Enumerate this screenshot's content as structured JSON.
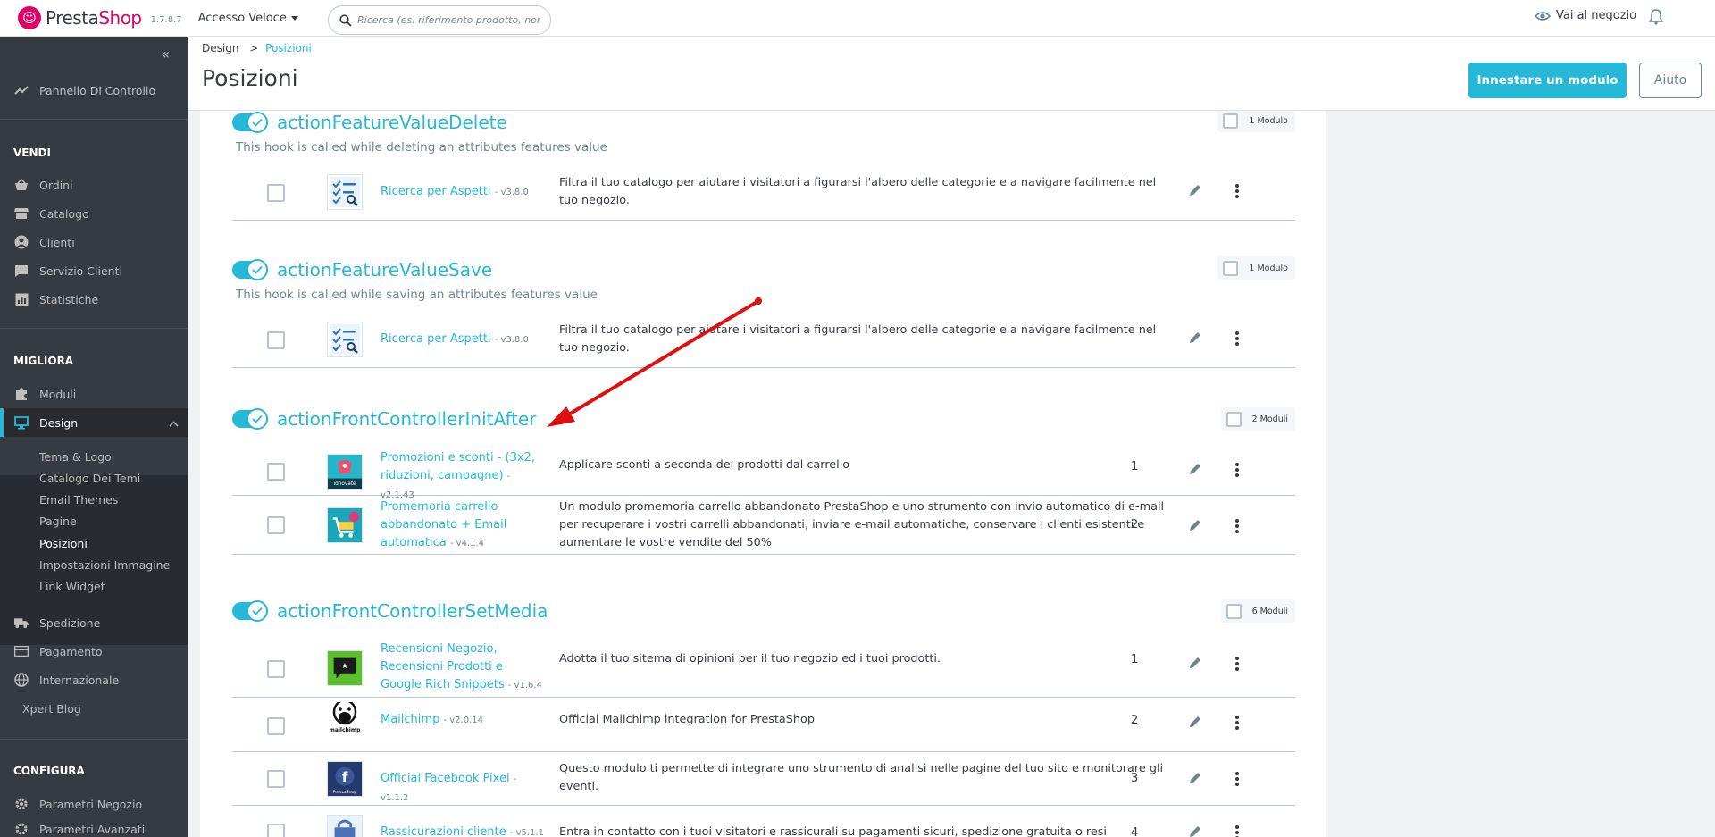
{
  "header": {
    "logo_prefix": "Presta",
    "logo_suffix": "Shop",
    "version": "1.7.8.7",
    "quick_access": "Accesso Veloce",
    "search_placeholder": "Ricerca (es. riferimento prodotto, nom",
    "shop_link": "Vai al negozio"
  },
  "sidebar": {
    "dashboard": "Pannello Di Controllo",
    "sections": {
      "sell": "VENDI",
      "improve": "MIGLIORA",
      "configure": "CONFIGURA"
    },
    "sell_items": [
      "Ordini",
      "Catalogo",
      "Clienti",
      "Servizio Clienti",
      "Statistiche"
    ],
    "improve_items": [
      "Moduli",
      "Design"
    ],
    "design_sub": [
      "Tema & Logo",
      "Catalogo Dei Temi",
      "Email Themes",
      "Pagine",
      "Posizioni",
      "Impostazioni Immagine",
      "Link Widget"
    ],
    "other_items": [
      "Spedizione",
      "Pagamento",
      "Internazionale",
      "Xpert Blog"
    ],
    "configure_items": [
      "Parametri Negozio",
      "Parametri Avanzati"
    ]
  },
  "page": {
    "breadcrumb_parent": "Design",
    "breadcrumb_sep": ">",
    "breadcrumb_current": "Posizioni",
    "title": "Posizioni",
    "primary_button": "Innestare un modulo",
    "help_button": "Aiuto"
  },
  "hooks": [
    {
      "name": "actionFeatureValueDelete",
      "description": "This hook is called while deleting an attributes features value",
      "count": "1 Modulo",
      "modules": [
        {
          "name": "Ricerca per Aspetti",
          "version": "- v3.8.0",
          "description": "Filtra il tuo catalogo per aiutare i visitatori a figurarsi l'albero delle categorie e a navigare facilmente nel tuo negozio.",
          "position": ""
        }
      ]
    },
    {
      "name": "actionFeatureValueSave",
      "description": "This hook is called while saving an attributes features value",
      "count": "1 Modulo",
      "modules": [
        {
          "name": "Ricerca per Aspetti",
          "version": "- v3.8.0",
          "description": "Filtra il tuo catalogo per aiutare i visitatori a figurarsi l'albero delle categorie e a navigare facilmente nel tuo negozio.",
          "position": ""
        }
      ]
    },
    {
      "name": "actionFrontControllerInitAfter",
      "description": "",
      "count": "2 Moduli",
      "modules": [
        {
          "name": "Promozioni e sconti - (3x2, riduzioni, campagne)",
          "version": "- v2.1.43",
          "description": "Applicare sconti a seconda dei prodotti dal carrello",
          "position": "1"
        },
        {
          "name": "Promemoria carrello abbandonato + Email automatica",
          "version": "- v4.1.4",
          "description": "Un modulo promemoria carrello abbandonato PrestaShop e uno strumento con invio automatico di e-mail per recuperare i vostri carrelli abbandonati, inviare e-mail automatiche, conservare i clienti esistenti e aumentare le vostre vendite del 50%",
          "position": "2"
        }
      ]
    },
    {
      "name": "actionFrontControllerSetMedia",
      "description": "",
      "count": "6 Moduli",
      "modules": [
        {
          "name": "Recensioni Negozio, Recensioni Prodotti e Google Rich Snippets",
          "version": "- v1.6.4",
          "description": "Adotta il tuo sitema di opinioni per il tuo negozio ed i tuoi prodotti.",
          "position": "1"
        },
        {
          "name": "Mailchimp",
          "version": "- v2.0.14",
          "description": "Official Mailchimp integration for PrestaShop",
          "position": "2"
        },
        {
          "name": "Official Facebook Pixel",
          "version": "- v1.1.2",
          "description": "Questo modulo ti permette di integrare uno strumento di analisi nelle pagine del tuo sito e monitorare gli eventi.",
          "position": "3"
        },
        {
          "name": "Rassicurazioni cliente",
          "version": "- v5.1.1",
          "description": "Entra in contatto con i tuoi visitatori e rassicurali su pagamenti sicuri, spedizione gratuita o resi",
          "position": "4"
        }
      ]
    }
  ],
  "icon_labels": {
    "idnovate": "idnovate",
    "mailchimp": "mailchimp",
    "facebook": "PrestaShop"
  },
  "colors": {
    "accent": "#25b9d7",
    "sidebar_bg": "#363a41",
    "annotation_arrow": "#e01010"
  }
}
